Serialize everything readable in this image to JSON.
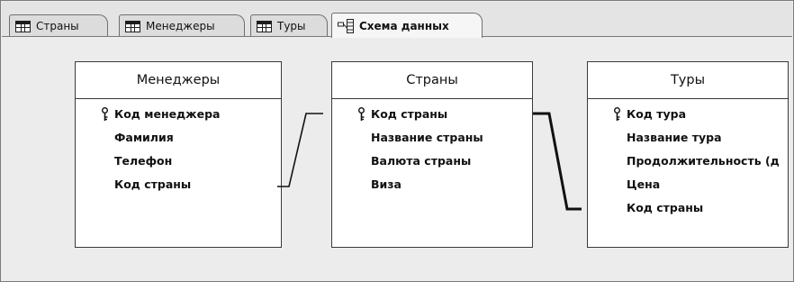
{
  "tabs": [
    {
      "label": "Страны",
      "icon": "table-icon",
      "active": false
    },
    {
      "label": "Менеджеры",
      "icon": "table-icon",
      "active": false
    },
    {
      "label": "Туры",
      "icon": "table-icon",
      "active": false
    },
    {
      "label": "Схема данных",
      "icon": "relationships-icon",
      "active": true
    }
  ],
  "tables": [
    {
      "title": "Менеджеры",
      "fields": [
        {
          "name": "Код менеджера",
          "primary_key": true
        },
        {
          "name": "Фамилия",
          "primary_key": false
        },
        {
          "name": "Телефон",
          "primary_key": false
        },
        {
          "name": "Код страны",
          "primary_key": false
        }
      ]
    },
    {
      "title": "Страны",
      "fields": [
        {
          "name": "Код страны",
          "primary_key": true
        },
        {
          "name": "Название страны",
          "primary_key": false
        },
        {
          "name": "Валюта страны",
          "primary_key": false
        },
        {
          "name": "Виза",
          "primary_key": false
        }
      ]
    },
    {
      "title": "Туры",
      "fields": [
        {
          "name": "Код тура",
          "primary_key": true
        },
        {
          "name": "Название тура",
          "primary_key": false
        },
        {
          "name": "Продолжительность (д",
          "primary_key": false
        },
        {
          "name": "Цена",
          "primary_key": false
        },
        {
          "name": "Код страны",
          "primary_key": false
        }
      ]
    }
  ],
  "relationships": [
    {
      "from": "Менеджеры.Код страны",
      "to": "Страны.Код страны"
    },
    {
      "from": "Страны.Код страны",
      "to": "Туры.Код страны"
    }
  ]
}
